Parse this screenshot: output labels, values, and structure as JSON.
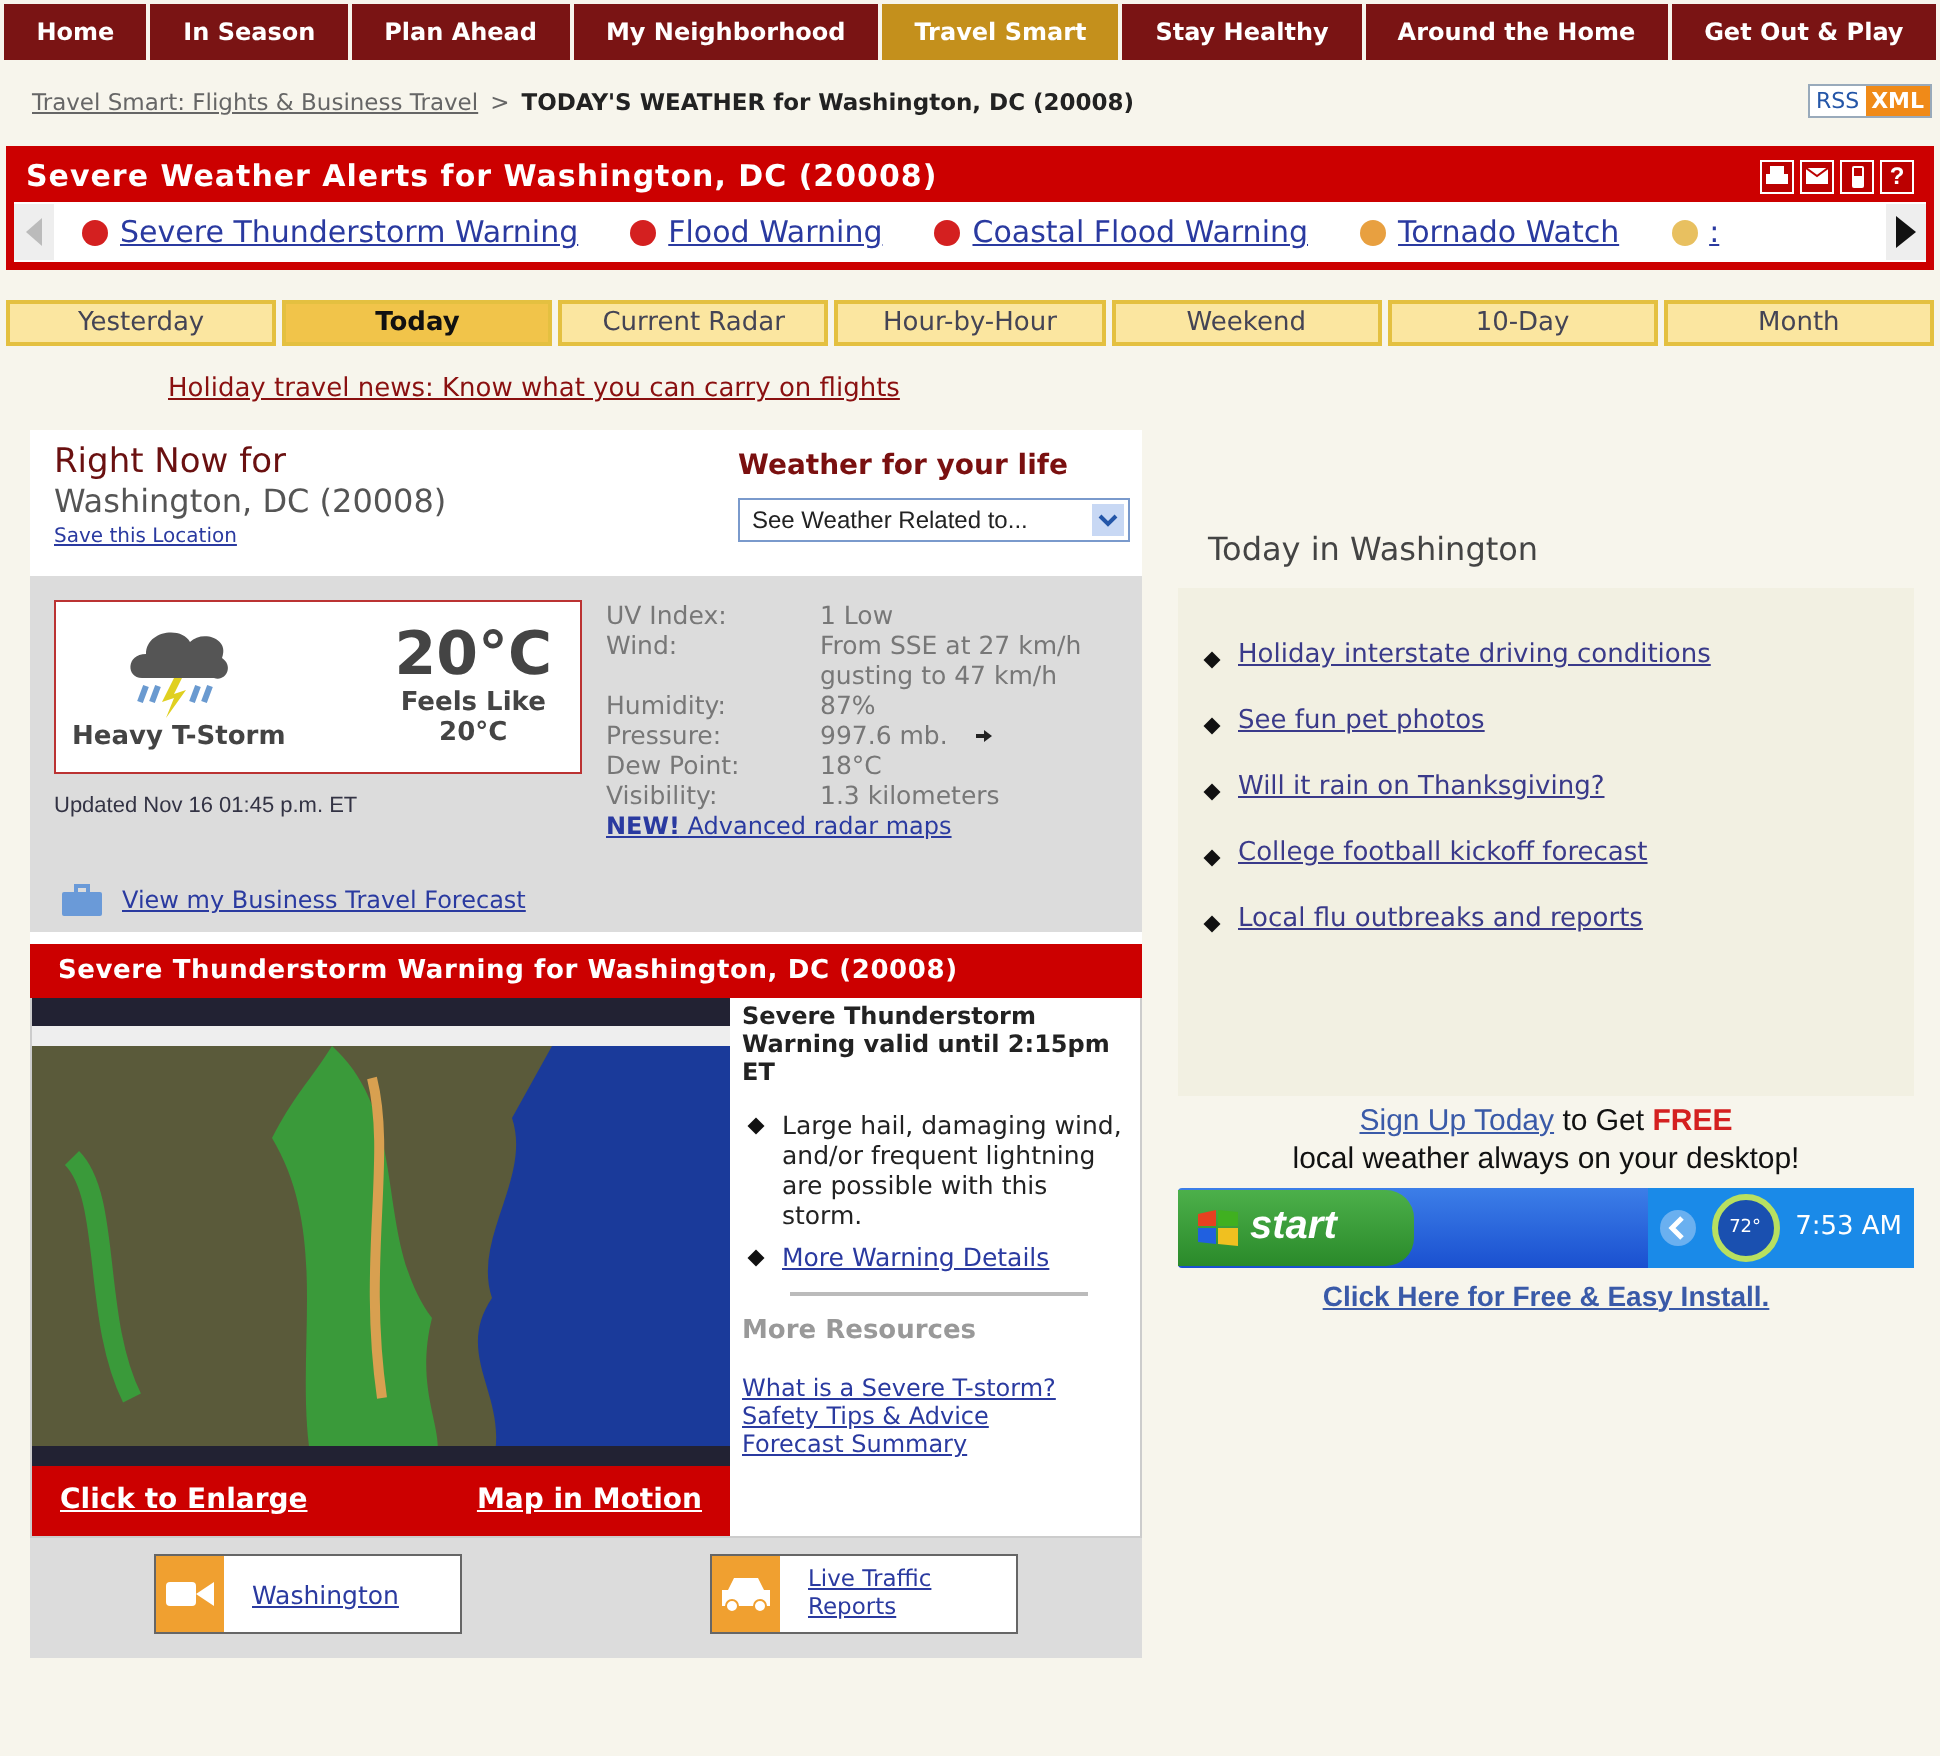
{
  "nav": [
    {
      "label": "Home",
      "selected": false
    },
    {
      "label": "In Season",
      "selected": false
    },
    {
      "label": "Plan Ahead",
      "selected": false
    },
    {
      "label": "My Neighborhood",
      "selected": false
    },
    {
      "label": "Travel Smart",
      "selected": true
    },
    {
      "label": "Stay Healthy",
      "selected": false
    },
    {
      "label": "Around the Home",
      "selected": false
    },
    {
      "label": "Get Out & Play",
      "selected": false
    }
  ],
  "breadcrumb": {
    "link": "Travel Smart: Flights & Business Travel",
    "separator": ">",
    "current": "TODAY'S WEATHER for Washington, DC (20008)"
  },
  "feed_badge": {
    "left": "RSS",
    "right": "XML"
  },
  "alerts": {
    "title": "Severe Weather Alerts for Washington, DC (20008)",
    "help": "?",
    "items": [
      {
        "label": "Severe Thunderstorm Warning",
        "color": "#d42020"
      },
      {
        "label": "Flood Warning",
        "color": "#d42020"
      },
      {
        "label": "Coastal Flood Warning",
        "color": "#d42020"
      },
      {
        "label": "Tornado Watch",
        "color": "#e8a040"
      },
      {
        "label": ":",
        "color": "#e8c060"
      }
    ]
  },
  "tabs": [
    {
      "label": "Yesterday",
      "selected": false
    },
    {
      "label": "Today",
      "selected": true
    },
    {
      "label": "Current Radar",
      "selected": false
    },
    {
      "label": "Hour-by-Hour",
      "selected": false
    },
    {
      "label": "Weekend",
      "selected": false
    },
    {
      "label": "10-Day",
      "selected": false
    },
    {
      "label": "Month",
      "selected": false
    }
  ],
  "news_link": "Holiday travel news: Know what you can carry on flights",
  "right_now": {
    "heading": "Right Now for",
    "location": "Washington, DC (20008)",
    "save_link": "Save this Location"
  },
  "weather_for_life": {
    "heading": "Weather for your life",
    "select": "See Weather Related to..."
  },
  "current": {
    "condition": "Heavy T-Storm",
    "temperature": "20°C",
    "feels_like_label": "Feels Like",
    "feels_like": "20°C",
    "updated": "Updated Nov 16 01:45 p.m. ET",
    "details": [
      {
        "kind": "plain",
        "label": "UV Index:",
        "values": [
          "1 Low"
        ]
      },
      {
        "kind": "plain",
        "label": "Wind:",
        "values": [
          "From SSE at 27 km/h",
          "gusting to 47 km/h"
        ]
      },
      {
        "kind": "plain",
        "label": "Humidity:",
        "values": [
          "87%"
        ]
      },
      {
        "kind": "arrow",
        "label": "Pressure:",
        "values": [
          "997.6 mb."
        ]
      },
      {
        "kind": "plain",
        "label": "Dew Point:",
        "values": [
          "18°C"
        ]
      },
      {
        "kind": "plain",
        "label": "Visibility:",
        "values": [
          "1.3 kilometers"
        ]
      }
    ],
    "radar_link": "**NEW!** Advanced radar maps",
    "business_link": "View my Business Travel Forecast"
  },
  "warning": {
    "title": "Severe Thunderstorm Warning for Washington, DC (20008)",
    "map_actions": [
      "Click to Enlarge",
      "Map in Motion"
    ],
    "headline": "Severe Thunderstorm Warning valid until 2:15pm ET",
    "bullets": [
      {
        "kind": "text",
        "text": "Large hail, damaging wind, and/or frequent lightning are possible with this storm."
      },
      {
        "kind": "link",
        "text": "More Warning Details"
      }
    ],
    "resources_heading": "More Resources",
    "resources": [
      "What is a Severe T-storm?",
      "Safety Tips & Advice",
      "Forecast Summary"
    ]
  },
  "bottom_links": [
    {
      "kind": "camera",
      "label": "Washington"
    },
    {
      "kind": "car",
      "label": "Live Traffic Reports"
    }
  ],
  "today": {
    "heading": "Today in Washington",
    "links": [
      "Holiday interstate driving conditions",
      "See fun pet photos",
      "Will it rain on Thanksgiving?",
      "College football kickoff forecast",
      "Local flu outbreaks and reports"
    ]
  },
  "promo": {
    "link": "Sign Up Today",
    "text": "to Get",
    "highlight": "FREE",
    "line2": "local weather always on your desktop!",
    "taskbar": {
      "start": "start",
      "temp": "72°",
      "time": "7:53 AM"
    },
    "install": "Click Here for Free & Easy Install."
  }
}
